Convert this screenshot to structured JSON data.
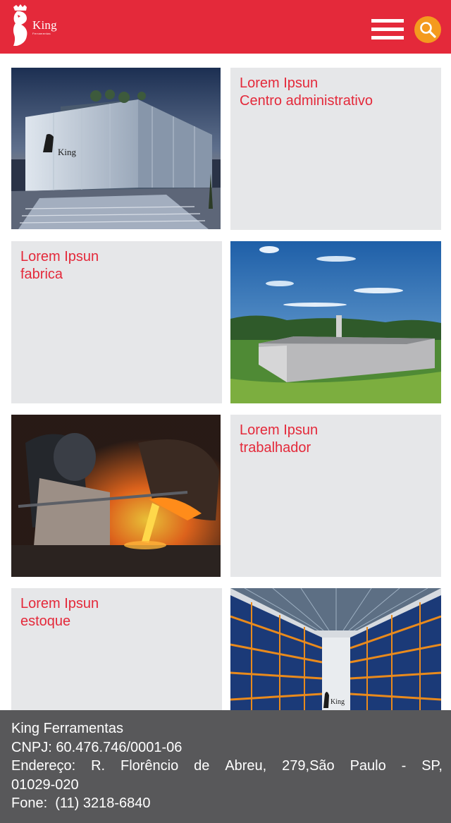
{
  "header": {
    "brand_name": "King",
    "brand_sub": "Ferramentas",
    "colors": {
      "bar": "#e4293a",
      "search": "#f49a1e"
    },
    "menu_icon": "hamburger-icon",
    "search_icon": "search-icon"
  },
  "cards": [
    {
      "photo": "administrative-building-photo",
      "title": "Lorem Ipsun",
      "subtitle": "Centro administrativo",
      "sign": "King"
    },
    {
      "photo": "factory-photo",
      "title": "Lorem Ipsun",
      "subtitle": "fabrica"
    },
    {
      "photo": "foundry-worker-photo",
      "title": "Lorem Ipsun",
      "subtitle": "trabalhador"
    },
    {
      "photo": "warehouse-photo",
      "title": "Lorem Ipsun",
      "subtitle": "estoque",
      "sign": "King"
    }
  ],
  "footer": {
    "company": "King Ferramentas",
    "cnpj": "CNPJ: 60.476.746/0001-06",
    "address_words": [
      "Endereço:",
      "R.",
      "Florêncio",
      "de",
      "Abreu,",
      "279,São",
      "Paulo",
      "-",
      "SP,"
    ],
    "address_cont": "01029-020",
    "phone": "Fone:  (11) 3218-6840"
  }
}
